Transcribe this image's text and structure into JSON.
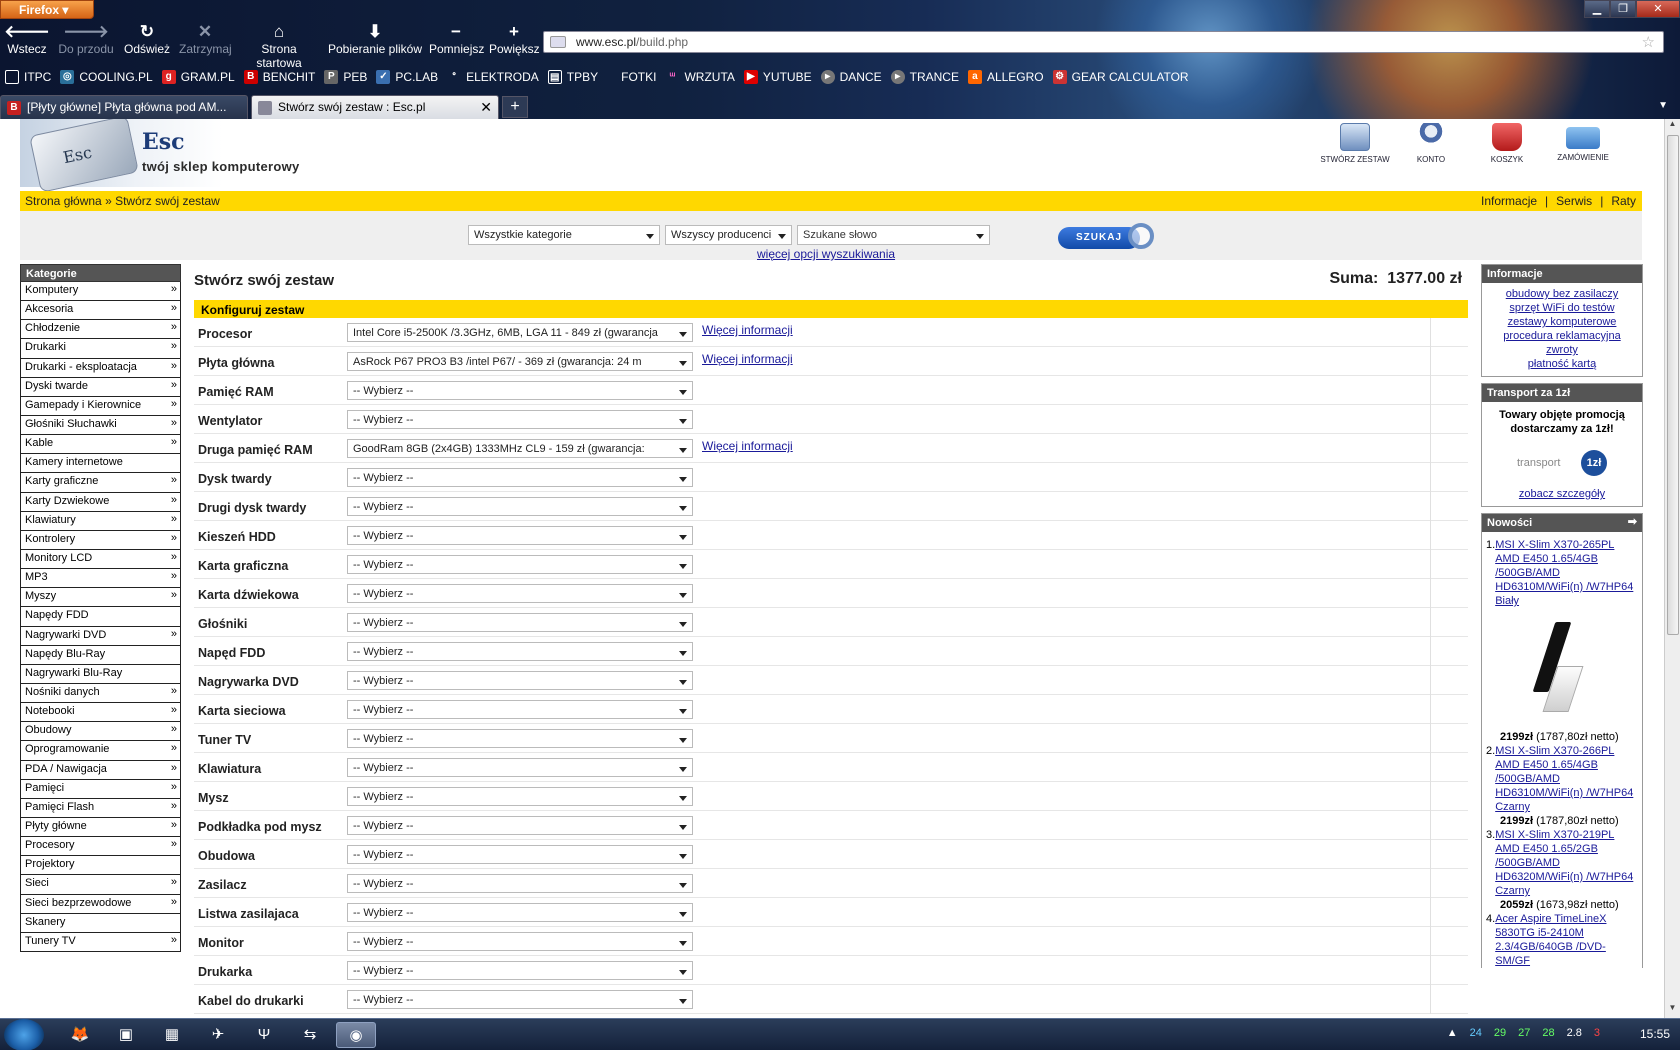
{
  "browser": {
    "app_button": "Firefox",
    "nav": {
      "back": "Wstecz",
      "forward": "Do przodu",
      "reload": "Odśwież",
      "stop": "Zatrzymaj",
      "home": "Strona startowa",
      "downloads": "Pobieranie plików",
      "zoom_out": "Pomniejsz",
      "zoom_in": "Powiększ"
    },
    "url_domain": "www.esc.pl",
    "url_path": "/build.php",
    "bookmarks": [
      "ITPC",
      "COOLING.PL",
      "GRAM.PL",
      "BENCHIT",
      "PEB",
      "PC.LAB",
      "ELEKTRODA",
      "TPBY",
      "FOTKI",
      "WRZUTA",
      "YUTUBE",
      "DANCE",
      "TRANCE",
      "ALLEGRO",
      "GEAR CALCULATOR"
    ],
    "tabs": [
      {
        "title": "[Płyty główne] Płyta główna pod AM..."
      },
      {
        "title": "Stwórz swój zestaw : Esc.pl"
      }
    ]
  },
  "site": {
    "logo_name": "Esc",
    "logo_key": "Esc",
    "tagline": "twój sklep komputerowy",
    "top_icons": [
      "STWÓRZ ZESTAW",
      "KONTO",
      "KOSZYK",
      "ZAMÓWIENIE"
    ],
    "breadcrumb": {
      "home": "Strona główna",
      "separator": "»",
      "current": "Stwórz swój zestaw"
    },
    "top_links": [
      "Informacje",
      "Serwis",
      "Raty"
    ],
    "top_links_sep": "|",
    "search": {
      "category": "Wszystkie kategorie",
      "producer": "Wszyscy producenci",
      "keyword_placeholder": "Szukane słowo",
      "button": "SZUKAJ",
      "more": "więcej opcji wyszukiwania"
    }
  },
  "sidebar": {
    "heading": "Kategorie",
    "items": [
      {
        "label": "Komputery",
        "arrow": "»"
      },
      {
        "label": "Akcesoria",
        "arrow": "»"
      },
      {
        "label": "Chłodzenie",
        "arrow": "»"
      },
      {
        "label": "Drukarki",
        "arrow": "»"
      },
      {
        "label": "Drukarki - eksploatacja",
        "arrow": "»"
      },
      {
        "label": "Dyski twarde",
        "arrow": "»"
      },
      {
        "label": "Gamepady i Kierownice",
        "arrow": "»"
      },
      {
        "label": "Głośniki Słuchawki",
        "arrow": "»"
      },
      {
        "label": "Kable",
        "arrow": "»"
      },
      {
        "label": "Kamery internetowe",
        "arrow": ""
      },
      {
        "label": "Karty graficzne",
        "arrow": "»"
      },
      {
        "label": "Karty Dzwiekowe",
        "arrow": "»"
      },
      {
        "label": "Klawiatury",
        "arrow": "»"
      },
      {
        "label": "Kontrolery",
        "arrow": "»"
      },
      {
        "label": "Monitory LCD",
        "arrow": "»"
      },
      {
        "label": "MP3",
        "arrow": "»"
      },
      {
        "label": "Myszy",
        "arrow": "»"
      },
      {
        "label": "Napędy FDD",
        "arrow": ""
      },
      {
        "label": "Nagrywarki DVD",
        "arrow": "»"
      },
      {
        "label": "Napędy Blu-Ray",
        "arrow": ""
      },
      {
        "label": "Nagrywarki Blu-Ray",
        "arrow": ""
      },
      {
        "label": "Nośniki danych",
        "arrow": "»"
      },
      {
        "label": "Notebooki",
        "arrow": "»"
      },
      {
        "label": "Obudowy",
        "arrow": "»"
      },
      {
        "label": "Oprogramowanie",
        "arrow": "»"
      },
      {
        "label": "PDA / Nawigacja",
        "arrow": "»"
      },
      {
        "label": "Pamięci",
        "arrow": "»"
      },
      {
        "label": "Pamięci Flash",
        "arrow": "»"
      },
      {
        "label": "Płyty główne",
        "arrow": "»"
      },
      {
        "label": "Procesory",
        "arrow": "»"
      },
      {
        "label": "Projektory",
        "arrow": ""
      },
      {
        "label": "Sieci",
        "arrow": "»"
      },
      {
        "label": "Sieci bezprzewodowe",
        "arrow": "»"
      },
      {
        "label": "Skanery",
        "arrow": ""
      },
      {
        "label": "Tunery TV",
        "arrow": "»"
      }
    ]
  },
  "main": {
    "title": "Stwórz swój zestaw",
    "sum_label": "Suma:",
    "sum_value": "1377.00 zł",
    "config_heading": "Konfiguruj zestaw",
    "more_info": "Więcej informacji",
    "rows": [
      {
        "label": "Procesor",
        "value": "Intel Core i5-2500K /3.3GHz, 6MB, LGA 11 - 849 zł (gwarancja",
        "more": true
      },
      {
        "label": "Płyta główna",
        "value": "AsRock P67 PRO3 B3 /intel P67/ - 369 zł (gwarancja: 24 m",
        "more": true
      },
      {
        "label": "Pamięć RAM",
        "value": "-- Wybierz --",
        "more": false
      },
      {
        "label": "Wentylator",
        "value": "-- Wybierz --",
        "more": false
      },
      {
        "label": "Druga pamięć RAM",
        "value": "GoodRam 8GB (2x4GB) 1333MHz CL9 - 159 zł (gwarancja:",
        "more": true
      },
      {
        "label": "Dysk twardy",
        "value": "-- Wybierz --",
        "more": false
      },
      {
        "label": "Drugi dysk twardy",
        "value": "-- Wybierz --",
        "more": false
      },
      {
        "label": "Kieszeń HDD",
        "value": "-- Wybierz --",
        "more": false
      },
      {
        "label": "Karta graficzna",
        "value": "-- Wybierz --",
        "more": false
      },
      {
        "label": "Karta dźwiekowa",
        "value": "-- Wybierz --",
        "more": false
      },
      {
        "label": "Głośniki",
        "value": "-- Wybierz --",
        "more": false
      },
      {
        "label": "Napęd FDD",
        "value": "-- Wybierz --",
        "more": false
      },
      {
        "label": "Nagrywarka DVD",
        "value": "-- Wybierz --",
        "more": false
      },
      {
        "label": "Karta sieciowa",
        "value": "-- Wybierz --",
        "more": false
      },
      {
        "label": "Tuner TV",
        "value": "-- Wybierz --",
        "more": false
      },
      {
        "label": "Klawiatura",
        "value": "-- Wybierz --",
        "more": false
      },
      {
        "label": "Mysz",
        "value": "-- Wybierz --",
        "more": false
      },
      {
        "label": "Podkładka pod mysz",
        "value": "-- Wybierz --",
        "more": false
      },
      {
        "label": "Obudowa",
        "value": "-- Wybierz --",
        "more": false
      },
      {
        "label": "Zasilacz",
        "value": "-- Wybierz --",
        "more": false
      },
      {
        "label": "Listwa zasilajaca",
        "value": "-- Wybierz --",
        "more": false
      },
      {
        "label": "Monitor",
        "value": "-- Wybierz --",
        "more": false
      },
      {
        "label": "Drukarka",
        "value": "-- Wybierz --",
        "more": false
      },
      {
        "label": "Kabel do drukarki",
        "value": "-- Wybierz --",
        "more": false
      }
    ]
  },
  "right": {
    "info": {
      "heading": "Informacje",
      "links": [
        "obudowy bez zasilaczy",
        "sprzęt WiFi do testów",
        "zestawy komputerowe",
        "procedura reklamacyjna",
        "zwroty",
        "płatność kartą"
      ]
    },
    "transport": {
      "heading": "Transport za 1zł",
      "text1": "Towary objęte promocją",
      "text2": "dostarczamy za 1zł!",
      "logo_word": "transport",
      "logo_badge": "1zł",
      "link": "zobacz szczegóły"
    },
    "news": {
      "heading": "Nowości",
      "icon": "➡",
      "items": [
        {
          "num": "1.",
          "title": "MSI X-Slim X370-265PL AMD E450 1.65/4GB /500GB/AMD HD6310M/WiFi(n) /W7HP64 Biały",
          "price": "2199zł",
          "net": "(1787,80zł netto)"
        },
        {
          "num": "2.",
          "title": "MSI X-Slim X370-266PL AMD E450 1.65/4GB /500GB/AMD HD6310M/WiFi(n) /W7HP64 Czarny",
          "price": "2199zł",
          "net": "(1787,80zł netto)"
        },
        {
          "num": "3.",
          "title": "MSI X-Slim X370-219PL AMD E450 1.65/2GB /500GB/AMD HD6320M/WiFi(n) /W7HP64 Czarny",
          "price": "2059zł",
          "net": "(1673,98zł netto)"
        },
        {
          "num": "4.",
          "title": "Acer Aspire TimeLineX 5830TG i5-2410M 2.3/4GB/640GB /DVD-SM/GF",
          "price": "",
          "net": ""
        }
      ]
    }
  },
  "taskbar": {
    "tray": [
      "24",
      "29",
      "27",
      "28",
      "2.8",
      "3"
    ],
    "clock": "15:55"
  }
}
